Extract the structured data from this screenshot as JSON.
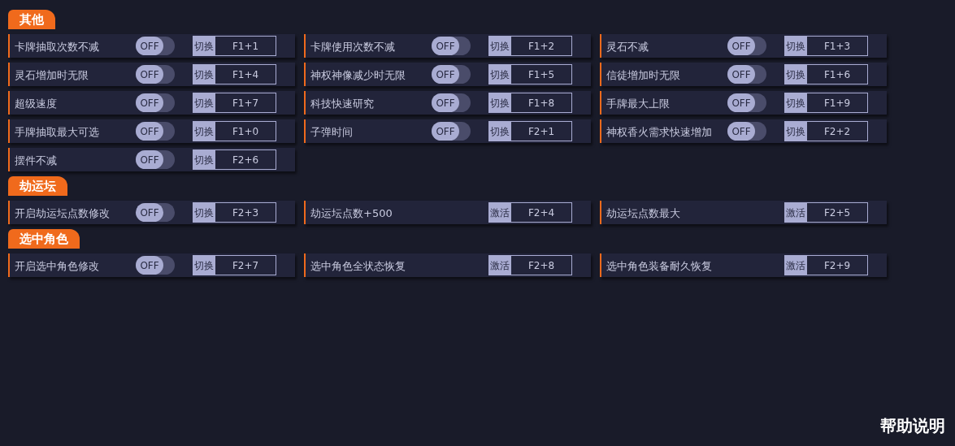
{
  "sections": [
    {
      "title": "其他",
      "items": [
        {
          "kind": "toggle",
          "label": "卡牌抽取次数不减",
          "switch_text": "OFF",
          "on": false,
          "action": "切换",
          "hotkey": "F1+1"
        },
        {
          "kind": "toggle",
          "label": "卡牌使用次数不减",
          "switch_text": "OFF",
          "on": false,
          "action": "切换",
          "hotkey": "F1+2"
        },
        {
          "kind": "toggle",
          "label": "灵石不减",
          "switch_text": "OFF",
          "on": false,
          "action": "切换",
          "hotkey": "F1+3"
        },
        {
          "kind": "toggle",
          "label": "灵石增加时无限",
          "switch_text": "OFF",
          "on": false,
          "action": "切换",
          "hotkey": "F1+4"
        },
        {
          "kind": "toggle",
          "label": "神权神像减少时无限",
          "switch_text": "OFF",
          "on": false,
          "action": "切换",
          "hotkey": "F1+5"
        },
        {
          "kind": "toggle",
          "label": "信徒增加时无限",
          "switch_text": "OFF",
          "on": false,
          "action": "切换",
          "hotkey": "F1+6"
        },
        {
          "kind": "toggle",
          "label": "超级速度",
          "switch_text": "OFF",
          "on": false,
          "action": "切换",
          "hotkey": "F1+7"
        },
        {
          "kind": "toggle",
          "label": "科技快速研究",
          "switch_text": "OFF",
          "on": false,
          "action": "切换",
          "hotkey": "F1+8"
        },
        {
          "kind": "toggle",
          "label": "手牌最大上限",
          "switch_text": "OFF",
          "on": false,
          "action": "切换",
          "hotkey": "F1+9"
        },
        {
          "kind": "toggle",
          "label": "手牌抽取最大可选",
          "switch_text": "OFF",
          "on": false,
          "action": "切换",
          "hotkey": "F1+0"
        },
        {
          "kind": "toggle",
          "label": "子弹时间",
          "switch_text": "OFF",
          "on": false,
          "action": "切换",
          "hotkey": "F2+1"
        },
        {
          "kind": "toggle",
          "label": "神权香火需求快速增加",
          "switch_text": "OFF",
          "on": false,
          "action": "切换",
          "hotkey": "F2+2"
        },
        {
          "kind": "toggle",
          "label": "摆件不减",
          "switch_text": "OFF",
          "on": false,
          "action": "切换",
          "hotkey": "F2+6"
        }
      ]
    },
    {
      "title": "劫运坛",
      "items": [
        {
          "kind": "toggle",
          "label": "开启劫运坛点数修改",
          "switch_text": "OFF",
          "on": false,
          "action": "切换",
          "hotkey": "F2+3"
        },
        {
          "kind": "button",
          "label": "劫运坛点数+500",
          "action": "激活",
          "hotkey": "F2+4"
        },
        {
          "kind": "button",
          "label": "劫运坛点数最大",
          "action": "激活",
          "hotkey": "F2+5"
        }
      ]
    },
    {
      "title": "选中角色",
      "items": [
        {
          "kind": "toggle",
          "label": "开启选中角色修改",
          "switch_text": "OFF",
          "on": false,
          "action": "切换",
          "hotkey": "F2+7"
        },
        {
          "kind": "button",
          "label": "选中角色全状态恢复",
          "action": "激活",
          "hotkey": "F2+8"
        },
        {
          "kind": "button",
          "label": "选中角色装备耐久恢复",
          "action": "激活",
          "hotkey": "F2+9"
        }
      ]
    }
  ],
  "help_link": "帮助说明"
}
